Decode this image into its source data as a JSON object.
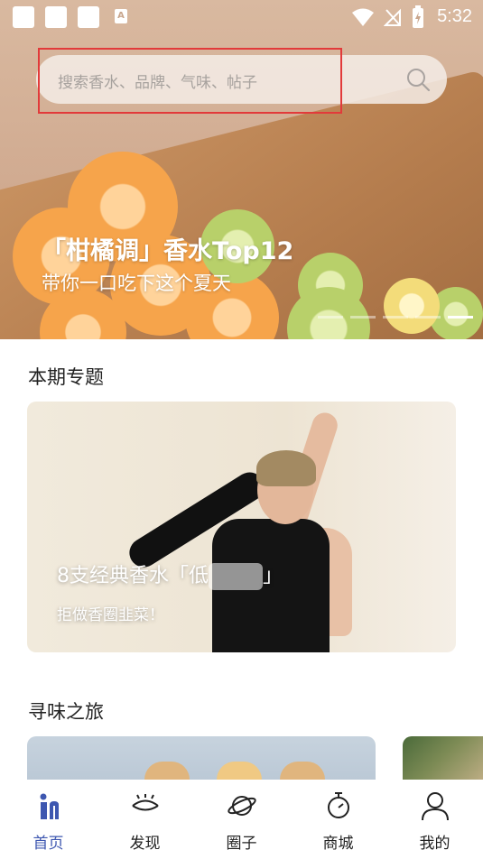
{
  "status_bar": {
    "time": "5:32",
    "notification_badge": "A"
  },
  "search": {
    "placeholder": "搜索香水、品牌、气味、帖子"
  },
  "hero": {
    "title": "「柑橘调」香水Top12",
    "subtitle": "带你一口吃下这个夏天",
    "carousel_count": 5,
    "active_index": 4
  },
  "sections": {
    "feature": {
      "title": "本期专题",
      "card_title": "8支经典香水「低",
      "card_title_end": "」",
      "card_subtitle": "拒做香圈韭菜！"
    },
    "journey": {
      "title": "寻味之旅"
    }
  },
  "nav": {
    "items": [
      {
        "label": "首页",
        "icon": "home-icon"
      },
      {
        "label": "发现",
        "icon": "eye-icon"
      },
      {
        "label": "圈子",
        "icon": "planet-icon"
      },
      {
        "label": "商城",
        "icon": "stopwatch-icon"
      },
      {
        "label": "我的",
        "icon": "person-icon"
      }
    ],
    "active_color": "#3e57b0"
  },
  "colors": {
    "accent": "#3e57b0",
    "highlight_box": "#e23a3a"
  }
}
